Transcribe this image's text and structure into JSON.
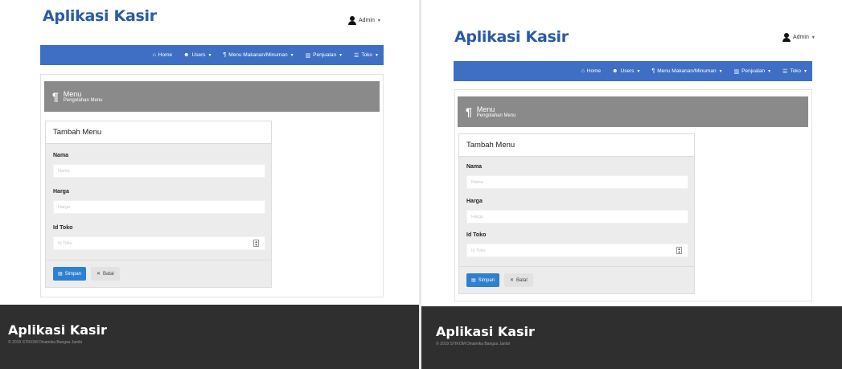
{
  "app": {
    "title": "Aplikasi Kasir"
  },
  "user": {
    "name": "Admin"
  },
  "nav": {
    "items": [
      {
        "label": "Home",
        "icon": "home-icon",
        "dropdown": false
      },
      {
        "label": "Users",
        "icon": "users-icon",
        "dropdown": true
      },
      {
        "label": "Menu Makanan/Minuman",
        "icon": "fork-knife-icon",
        "dropdown": true
      },
      {
        "label": "Penjualan",
        "icon": "bar-chart-icon",
        "dropdown": true
      },
      {
        "label": "Toko",
        "icon": "list-icon",
        "dropdown": true
      }
    ]
  },
  "page_header": {
    "title": "Menu",
    "subtitle": "Pengolahan Menu"
  },
  "form": {
    "heading": "Tambah Menu",
    "fields": [
      {
        "label": "Nama",
        "placeholder": "Nama"
      },
      {
        "label": "Harga",
        "placeholder": "Harga"
      },
      {
        "label": "Id Toko",
        "placeholder": "Id Toko"
      }
    ],
    "save_label": "Simpan",
    "cancel_label": "Batal"
  },
  "footer": {
    "title": "Aplikasi Kasir",
    "copyright": "© 2019 STIKOM Dinamika Bangsa Jambi"
  },
  "colors": {
    "brand": "#2a5aa8",
    "navbar": "#3f6fc4",
    "header": "#8a8a8a",
    "footer": "#2f2f2f",
    "save": "#2f7fd0"
  }
}
